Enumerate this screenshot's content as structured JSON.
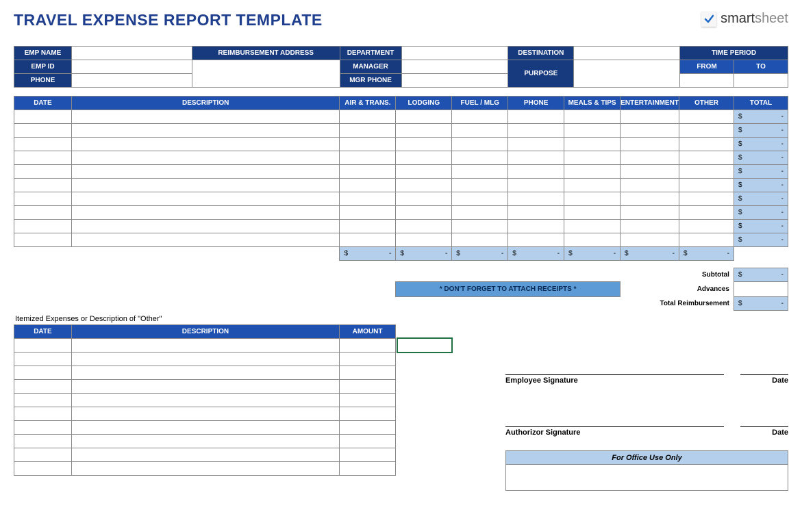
{
  "title": "TRAVEL EXPENSE REPORT TEMPLATE",
  "brand": {
    "part1": "smart",
    "part2": "sheet"
  },
  "info": {
    "empName": "EMP NAME",
    "empId": "EMP ID",
    "phone": "PHONE",
    "reimbAddr": "REIMBURSEMENT ADDRESS",
    "department": "DEPARTMENT",
    "manager": "MANAGER",
    "mgrPhone": "MGR PHONE",
    "destination": "DESTINATION",
    "purpose": "PURPOSE",
    "timePeriod": "TIME PERIOD",
    "from": "FROM",
    "to": "TO"
  },
  "expHeaders": [
    "DATE",
    "DESCRIPTION",
    "AIR & TRANS.",
    "LODGING",
    "FUEL / MLG",
    "PHONE",
    "MEALS & TIPS",
    "ENTERTAINMENT",
    "OTHER",
    "TOTAL"
  ],
  "expenseRows": 10,
  "columnTotal": {
    "dollar": "$",
    "dash": "-"
  },
  "rowTotal": {
    "dollar": "$",
    "dash": "-"
  },
  "attachNote": "* DON'T FORGET TO ATTACH RECEIPTS *",
  "summary": {
    "subtotal": "Subtotal",
    "advances": "Advances",
    "totalReimb": "Total Reimbursement"
  },
  "itemizedNote": "Itemized Expenses or Description of \"Other\"",
  "itemHeaders": [
    "DATE",
    "DESCRIPTION",
    "AMOUNT"
  ],
  "itemRows": 10,
  "sig": {
    "employee": "Employee Signature",
    "authorizor": "Authorizor Signature",
    "date": "Date",
    "office": "For Office Use Only"
  }
}
